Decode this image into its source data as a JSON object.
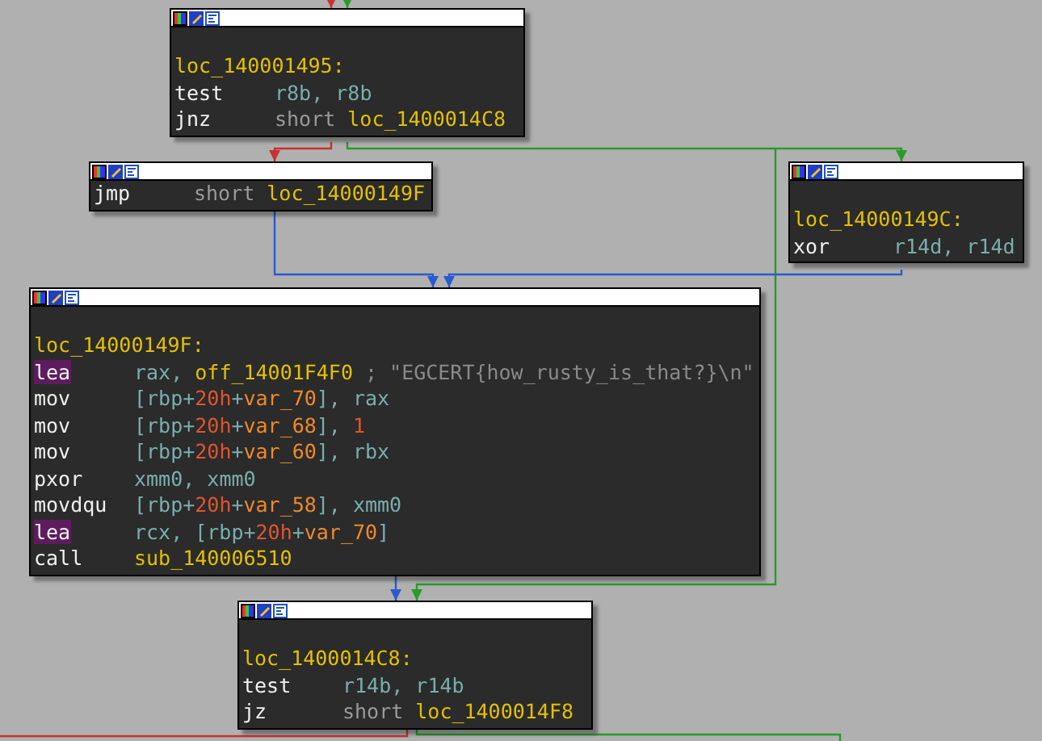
{
  "nodes": [
    {
      "label": "loc_140001495:",
      "instructions": [
        {
          "mnemonic": "test",
          "highlighted": false,
          "operands": [
            {
              "kind": "reg",
              "text": "r8b"
            },
            {
              "kind": "punct",
              "text": ", "
            },
            {
              "kind": "reg",
              "text": "r8b"
            }
          ]
        },
        {
          "mnemonic": "jnz",
          "highlighted": false,
          "operands": [
            {
              "kind": "keyword",
              "text": "short "
            },
            {
              "kind": "label",
              "text": "loc_1400014C8"
            }
          ]
        }
      ]
    },
    {
      "instructions": [
        {
          "mnemonic": "jmp",
          "highlighted": false,
          "operands": [
            {
              "kind": "keyword",
              "text": "short "
            },
            {
              "kind": "label",
              "text": "loc_14000149F"
            }
          ]
        }
      ]
    },
    {
      "label": "loc_14000149C:",
      "instructions": [
        {
          "mnemonic": "xor",
          "highlighted": false,
          "operands": [
            {
              "kind": "reg",
              "text": "r14d"
            },
            {
              "kind": "punct",
              "text": ", "
            },
            {
              "kind": "reg",
              "text": "r14d"
            }
          ]
        }
      ]
    },
    {
      "label": "loc_14000149F:",
      "instructions": [
        {
          "mnemonic": "lea",
          "highlighted": true,
          "operands": [
            {
              "kind": "reg",
              "text": "rax"
            },
            {
              "kind": "punct",
              "text": ", "
            },
            {
              "kind": "label",
              "text": "off_14001F4F0 "
            },
            {
              "kind": "comment",
              "text": "; \"EGCERT{how_rusty_is_that?}\\n\""
            }
          ]
        },
        {
          "mnemonic": "mov",
          "highlighted": false,
          "operands": [
            {
              "kind": "punct",
              "text": "["
            },
            {
              "kind": "reg",
              "text": "rbp"
            },
            {
              "kind": "punct",
              "text": "+"
            },
            {
              "kind": "num",
              "text": "20h"
            },
            {
              "kind": "punct",
              "text": "+"
            },
            {
              "kind": "var",
              "text": "var_70"
            },
            {
              "kind": "punct",
              "text": "], "
            },
            {
              "kind": "reg",
              "text": "rax"
            }
          ]
        },
        {
          "mnemonic": "mov",
          "highlighted": false,
          "operands": [
            {
              "kind": "punct",
              "text": "["
            },
            {
              "kind": "reg",
              "text": "rbp"
            },
            {
              "kind": "punct",
              "text": "+"
            },
            {
              "kind": "num",
              "text": "20h"
            },
            {
              "kind": "punct",
              "text": "+"
            },
            {
              "kind": "var",
              "text": "var_68"
            },
            {
              "kind": "punct",
              "text": "], "
            },
            {
              "kind": "num",
              "text": "1"
            }
          ]
        },
        {
          "mnemonic": "mov",
          "highlighted": false,
          "operands": [
            {
              "kind": "punct",
              "text": "["
            },
            {
              "kind": "reg",
              "text": "rbp"
            },
            {
              "kind": "punct",
              "text": "+"
            },
            {
              "kind": "num",
              "text": "20h"
            },
            {
              "kind": "punct",
              "text": "+"
            },
            {
              "kind": "var",
              "text": "var_60"
            },
            {
              "kind": "punct",
              "text": "], "
            },
            {
              "kind": "reg",
              "text": "rbx"
            }
          ]
        },
        {
          "mnemonic": "pxor",
          "highlighted": false,
          "operands": [
            {
              "kind": "reg",
              "text": "xmm0"
            },
            {
              "kind": "punct",
              "text": ", "
            },
            {
              "kind": "reg",
              "text": "xmm0"
            }
          ]
        },
        {
          "mnemonic": "movdqu",
          "highlighted": false,
          "operands": [
            {
              "kind": "punct",
              "text": "["
            },
            {
              "kind": "reg",
              "text": "rbp"
            },
            {
              "kind": "punct",
              "text": "+"
            },
            {
              "kind": "num",
              "text": "20h"
            },
            {
              "kind": "punct",
              "text": "+"
            },
            {
              "kind": "var",
              "text": "var_58"
            },
            {
              "kind": "punct",
              "text": "], "
            },
            {
              "kind": "reg",
              "text": "xmm0"
            }
          ]
        },
        {
          "mnemonic": "lea",
          "highlighted": true,
          "operands": [
            {
              "kind": "reg",
              "text": "rcx"
            },
            {
              "kind": "punct",
              "text": ", ["
            },
            {
              "kind": "reg",
              "text": "rbp"
            },
            {
              "kind": "punct",
              "text": "+"
            },
            {
              "kind": "num",
              "text": "20h"
            },
            {
              "kind": "punct",
              "text": "+"
            },
            {
              "kind": "var",
              "text": "var_70"
            },
            {
              "kind": "punct",
              "text": "]"
            }
          ]
        },
        {
          "mnemonic": "call",
          "highlighted": false,
          "operands": [
            {
              "kind": "label",
              "text": "sub_140006510"
            }
          ]
        }
      ]
    },
    {
      "label": "loc_1400014C8:",
      "instructions": [
        {
          "mnemonic": "test",
          "highlighted": false,
          "operands": [
            {
              "kind": "reg",
              "text": "r14b"
            },
            {
              "kind": "punct",
              "text": ", "
            },
            {
              "kind": "reg",
              "text": "r14b"
            }
          ]
        },
        {
          "mnemonic": "jz",
          "highlighted": false,
          "operands": [
            {
              "kind": "keyword",
              "text": "short "
            },
            {
              "kind": "label",
              "text": "loc_1400014F8"
            }
          ]
        }
      ]
    }
  ],
  "edges": [
    {
      "kind": "false"
    },
    {
      "kind": "true"
    },
    {
      "kind": "false"
    },
    {
      "kind": "true"
    },
    {
      "kind": "true"
    },
    {
      "kind": "jump"
    },
    {
      "kind": "jump"
    },
    {
      "kind": "jump"
    },
    {
      "kind": "false"
    },
    {
      "kind": "true"
    }
  ]
}
